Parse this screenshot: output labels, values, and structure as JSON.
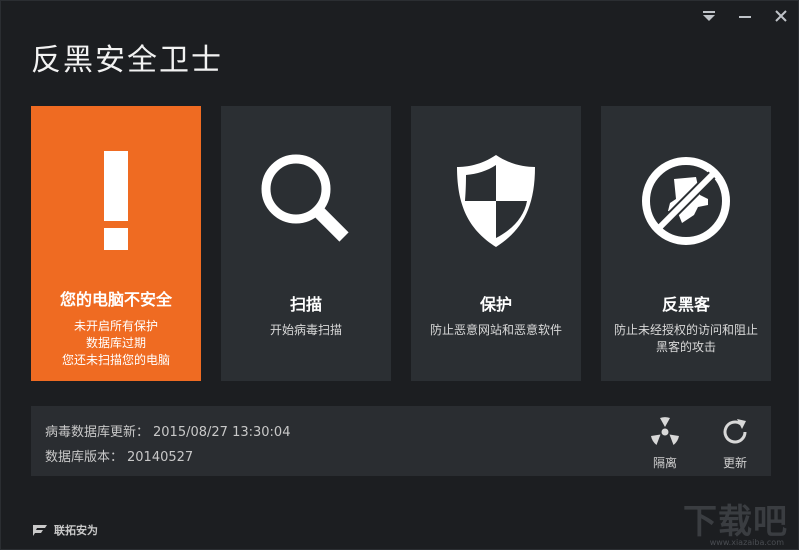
{
  "app": {
    "title": "反黑安全卫士"
  },
  "window_controls": {
    "menu_icon": "triangle-down-icon",
    "minimize_icon": "minimize-icon",
    "close_icon": "close-icon"
  },
  "tiles": [
    {
      "icon": "exclamation-icon",
      "title": "您的电脑不安全",
      "desc": [
        "未开启所有保护",
        "数据库过期",
        "您还未扫描您的电脑"
      ],
      "color": "#ef6b22"
    },
    {
      "icon": "magnifier-icon",
      "title": "扫描",
      "desc": [
        "开始病毒扫描"
      ]
    },
    {
      "icon": "shield-icon",
      "title": "保护",
      "desc": [
        "防止恶意网站和恶意软件"
      ]
    },
    {
      "icon": "anti-hacker-icon",
      "title": "反黑客",
      "desc": [
        "防止未经授权的访问和阻止",
        "黑客的攻击"
      ]
    }
  ],
  "info": {
    "db_update_label": "病毒数据库更新：",
    "db_update_value": "2015/08/27 13:30:04",
    "db_version_label": "数据库版本：",
    "db_version_value": "20140527"
  },
  "actions": {
    "quarantine": {
      "icon": "radiation-icon",
      "label": "隔离"
    },
    "update": {
      "icon": "refresh-icon",
      "label": "更新"
    }
  },
  "footer": {
    "brand": "联拓安为"
  },
  "watermark": {
    "text": "下载吧",
    "url": "www.xiazaiba.com"
  },
  "colors": {
    "accent": "#ef6b22",
    "tile_bg": "#2b2f33",
    "window_bg": "#1c1e21"
  }
}
